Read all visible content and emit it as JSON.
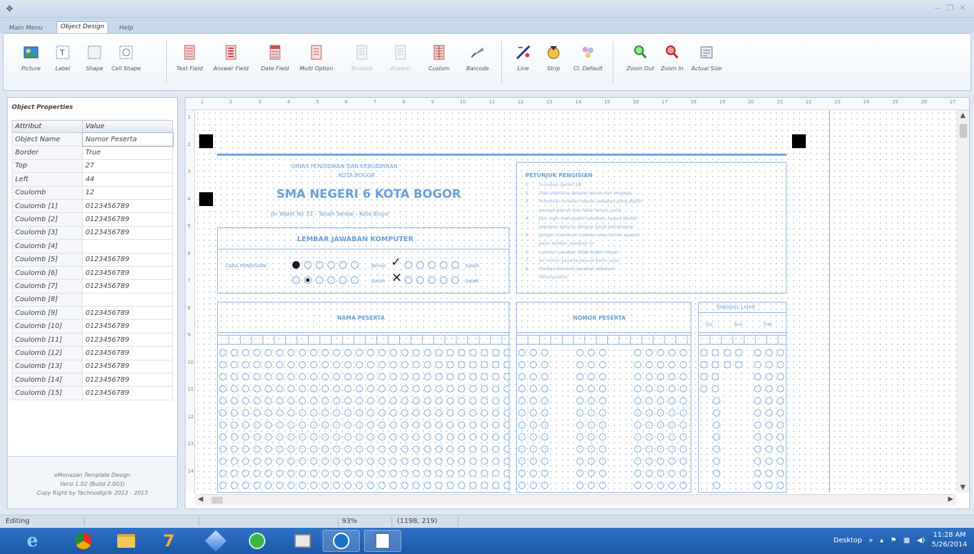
{
  "window": {
    "title": ""
  },
  "tabs": [
    {
      "label": "Main Menu",
      "active": false
    },
    {
      "label": "Object Design",
      "active": true
    },
    {
      "label": "Help",
      "active": false
    }
  ],
  "ribbon": {
    "buttons": [
      {
        "label": "Picture",
        "icon": "picture-icon",
        "enabled": true
      },
      {
        "label": "Label",
        "icon": "label-icon",
        "enabled": true
      },
      {
        "label": "Shape",
        "icon": "shape-icon",
        "enabled": true
      },
      {
        "label": "Cell Shape",
        "icon": "cell-shape-icon",
        "enabled": true
      },
      {
        "label": "Text Field",
        "icon": "text-field-icon",
        "enabled": true
      },
      {
        "label": "Answer Field",
        "icon": "answer-field-icon",
        "enabled": true
      },
      {
        "label": "Date Field",
        "icon": "date-field-icon",
        "enabled": true
      },
      {
        "label": "Multi Option",
        "icon": "multi-option-icon",
        "enabled": true
      },
      {
        "label": "Biodata",
        "icon": "biodata-icon",
        "enabled": false
      },
      {
        "label": "Answer",
        "icon": "answer-icon",
        "enabled": false
      },
      {
        "label": "Custom",
        "icon": "custom-icon",
        "enabled": true
      },
      {
        "label": "Barcode",
        "icon": "barcode-icon",
        "enabled": true
      },
      {
        "label": "Line",
        "icon": "line-icon",
        "enabled": true
      },
      {
        "label": "Strip",
        "icon": "strip-icon",
        "enabled": true
      },
      {
        "label": "Cl. Default",
        "icon": "clear-default-icon",
        "enabled": true
      },
      {
        "label": "Zoom Out",
        "icon": "zoom-out-icon",
        "enabled": true
      },
      {
        "label": "Zoom In",
        "icon": "zoom-in-icon",
        "enabled": true
      },
      {
        "label": "Actual Size",
        "icon": "actual-size-icon",
        "enabled": true
      }
    ]
  },
  "properties": {
    "title": "Object Properties",
    "headers": {
      "attr": "Attribut",
      "value": "Value"
    },
    "rows": [
      {
        "attr": "Object Name",
        "value": "Nomor Peserta"
      },
      {
        "attr": "Border",
        "value": "True"
      },
      {
        "attr": "Top",
        "value": "27"
      },
      {
        "attr": "Left",
        "value": "44"
      },
      {
        "attr": "Coulomb",
        "value": "12"
      },
      {
        "attr": "Coulomb [1]",
        "value": "0123456789"
      },
      {
        "attr": "Coulomb [2]",
        "value": "0123456789"
      },
      {
        "attr": "Coulomb [3]",
        "value": "0123456789"
      },
      {
        "attr": "Coulomb [4]",
        "value": ""
      },
      {
        "attr": "Coulomb [5]",
        "value": "0123456789"
      },
      {
        "attr": "Coulomb [6]",
        "value": "0123456789"
      },
      {
        "attr": "Coulomb [7]",
        "value": "0123456789"
      },
      {
        "attr": "Coulomb [8]",
        "value": ""
      },
      {
        "attr": "Coulomb [9]",
        "value": "0123456789"
      },
      {
        "attr": "Coulomb [10]",
        "value": "0123456789"
      },
      {
        "attr": "Coulomb [11]",
        "value": "0123456789"
      },
      {
        "attr": "Coulomb [12]",
        "value": "0123456789"
      },
      {
        "attr": "Coulomb [13]",
        "value": "0123456789"
      },
      {
        "attr": "Coulomb [14]",
        "value": "0123456789"
      },
      {
        "attr": "Coulomb [15]",
        "value": "0123456789"
      }
    ]
  },
  "about": {
    "line1": "eMonazan Template Design",
    "line2": "Versi 1.02 (Build 2.003)",
    "line3": "Copy Right by Technodigi® 2012 - 2013"
  },
  "ruler": {
    "top": [
      "1",
      "2",
      "3",
      "4",
      "5",
      "6",
      "7",
      "8",
      "9",
      "10",
      "11",
      "12",
      "13",
      "14",
      "15",
      "16",
      "17",
      "18",
      "19",
      "20",
      "21",
      "22",
      "23",
      "24",
      "25",
      "26",
      "27"
    ],
    "left": [
      "1",
      "2",
      "3",
      "4",
      "5",
      "6",
      "7",
      "8",
      "9",
      "10",
      "11",
      "12",
      "13",
      "14"
    ]
  },
  "sheet": {
    "agency_line1": "DINAS PENDIDIKAN DAN KEBUDAYAAN",
    "agency_line2": "KOTA BOGOR",
    "school_name": "SMA NEGERI 6 KOTA BOGOR",
    "address": "Jln Walet No 33 - Tanah Sereal - Kota Bogor",
    "sheet_title": "LEMBAR JAWABAN KOMPUTER",
    "fill_method_label": "CARA PENGISIAN :",
    "correct_label": "Benar",
    "wrong_label": "Salah",
    "instructions_title": "PETUNJUK PENGISIAN",
    "instructions": [
      {
        "num": "1.",
        "text": "Gunakan pensil 2B"
      },
      {
        "num": "2.",
        "text": "Tulis identitas dengan benar dan lengkap"
      },
      {
        "num": "3.",
        "text": "Hitamkan bulatan sesuai jawaban yang dipilih"
      },
      {
        "num": "",
        "text": "sampai penuh dan tidak keluar garis"
      },
      {
        "num": "4.",
        "text": "Jika ingin mengganti jawaban, hapus bersih"
      },
      {
        "num": "",
        "text": "jawaban semula dengan karet penghapus"
      },
      {
        "num": "5.",
        "text": "Jangan membuat coretan atau tanda apapun"
      },
      {
        "num": "",
        "text": "pada lembar jawaban ini"
      },
      {
        "num": "6.",
        "text": "Lembar jawaban tidak boleh dilipat"
      },
      {
        "num": "7.",
        "text": "Isi nomor peserta sesuai kartu ujian"
      },
      {
        "num": "8.",
        "text": "Periksa kembali jawaban sebelum"
      },
      {
        "num": "",
        "text": "dikumpulkan"
      }
    ],
    "name_label": "NAMA PESERTA",
    "number_label": "NOMOR PESERTA",
    "birthdate_label": "TANGGAL LAHIR",
    "tgl_label": "TGL",
    "bln_label": "BLN",
    "thn_label": "THN"
  },
  "status": {
    "mode": "Editing",
    "zoom": "93%",
    "coords": "(1198, 219)"
  },
  "taskbar": {
    "desktop_label": "Desktop",
    "time": "11:28 AM",
    "date": "5/26/2014"
  }
}
